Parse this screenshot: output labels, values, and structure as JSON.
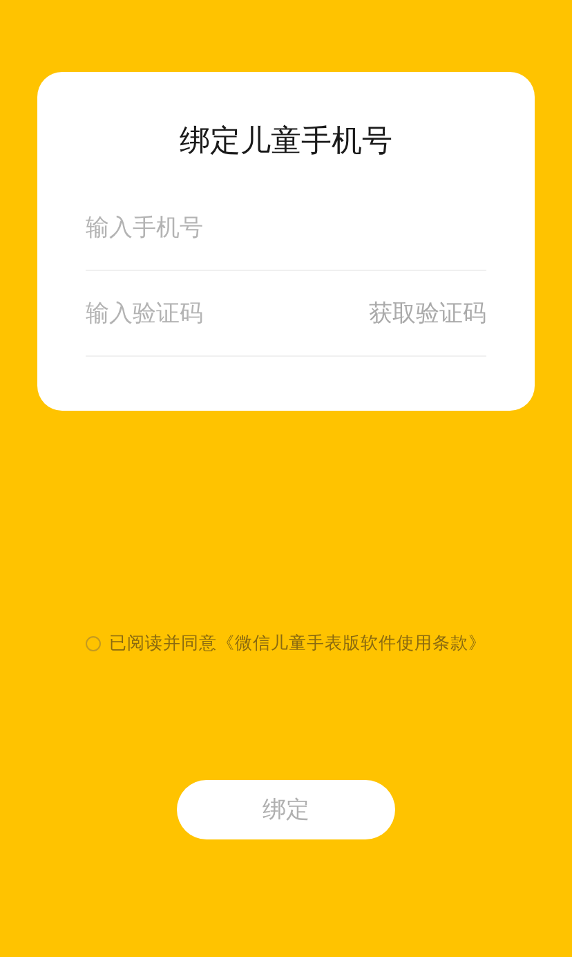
{
  "card": {
    "title": "绑定儿童手机号",
    "fields": [
      {
        "placeholder": "输入手机号"
      },
      {
        "placeholder": "输入验证码",
        "action": "获取验证码"
      }
    ]
  },
  "agreement": {
    "checked": false,
    "text": "已阅读并同意",
    "link": "《微信儿童手表版软件使用条款》"
  },
  "submit": {
    "label": "绑定",
    "disabled": true
  }
}
